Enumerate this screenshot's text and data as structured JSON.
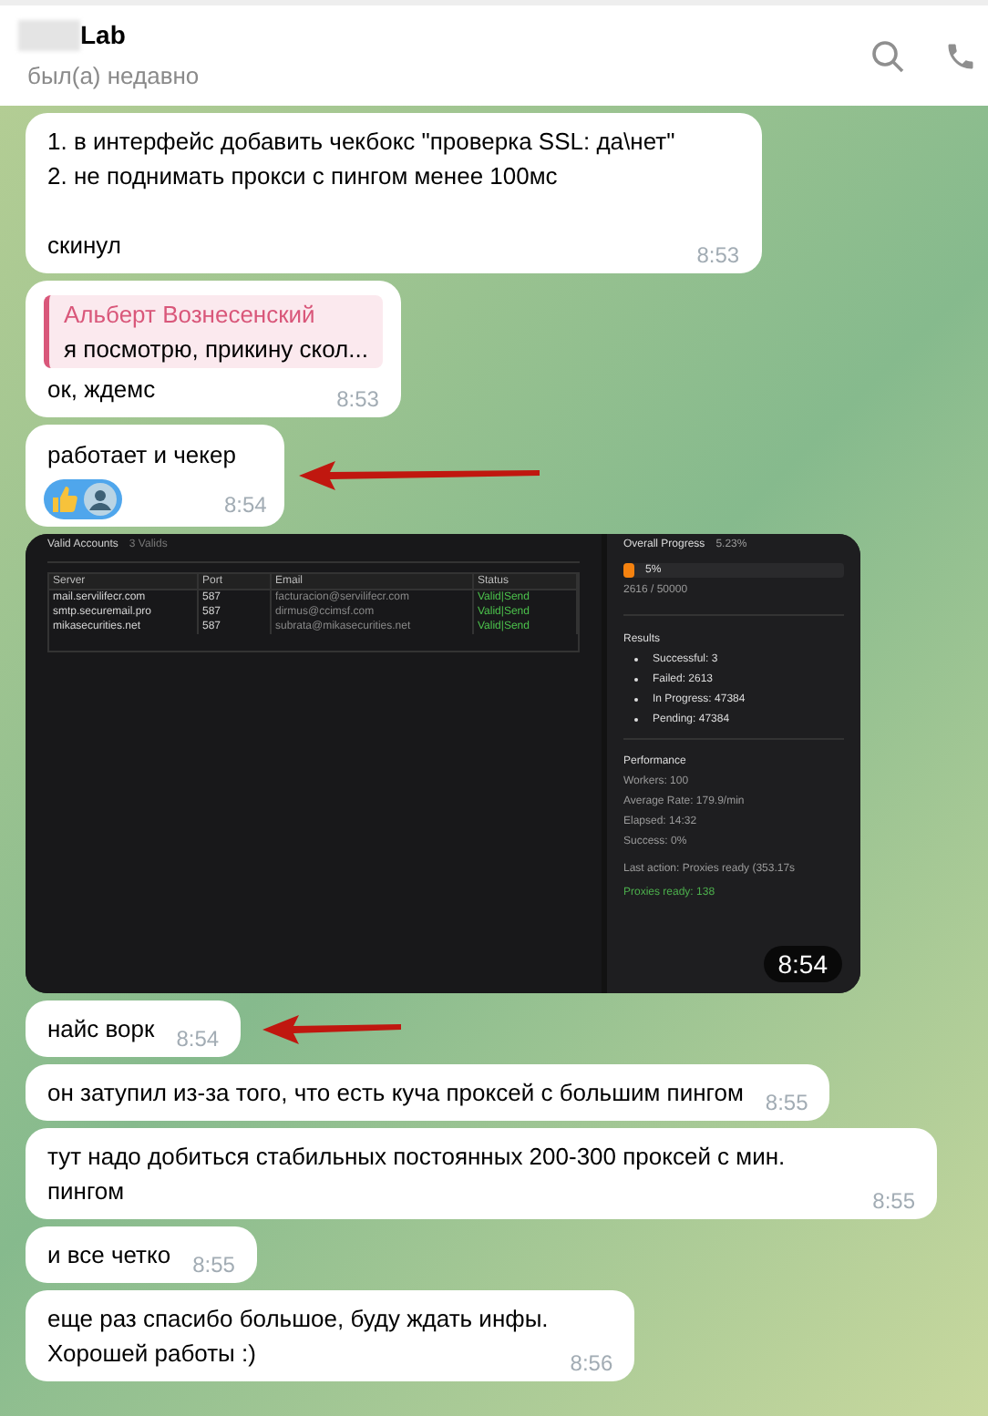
{
  "header": {
    "title": "Lab",
    "status": "был(а) недавно"
  },
  "messages": [
    {
      "kind": "text",
      "text": "1. в интерфейс добавить чекбокс \"проверка SSL: да\\нет\"\n2. не поднимать прокси с пингом менее 100мс\n\nскинул",
      "time": "8:53",
      "marked_with_arrow": false
    },
    {
      "kind": "reply",
      "reply_author": "Альберт Вознесенский",
      "reply_text": "я посмотрю, прикину скол...",
      "text": "ок, ждемс",
      "time": "8:53",
      "marked_with_arrow": false
    },
    {
      "kind": "reactions",
      "text": "работает и чекер",
      "time": "8:54",
      "marked_with_arrow": true
    },
    {
      "kind": "image",
      "time": "8:54",
      "marked_with_arrow": false,
      "screenshot": {
        "title": "Valid Accounts",
        "count": "3 Valids",
        "columns": [
          "Server",
          "Port",
          "Email",
          "Status"
        ],
        "rows": [
          [
            "mail.servilifecr.com",
            "587",
            "facturacion@servilifecr.com",
            "Valid|Send"
          ],
          [
            "smtp.securemail.pro",
            "587",
            "dirmus@ccimsf.com",
            "Valid|Send"
          ],
          [
            "mikasecurities.net",
            "587",
            "subrata@mikasecurities.net",
            "Valid|Send"
          ]
        ],
        "progress_title": "Overall Progress",
        "progress_percent": "5.23%",
        "level": 0.05,
        "progress_label": "5%",
        "progress_count": "2616 / 50000",
        "results_title": "Results",
        "results": [
          "Successful: 3",
          "Failed: 2613",
          "In Progress: 47384",
          "Pending: 47384"
        ],
        "performance_title": "Performance",
        "performance": [
          "Workers: 100",
          "Average Rate: 179.9/min",
          "Elapsed: 14:32",
          "Success: 0%"
        ],
        "last_action": "Last action: Proxies ready   (353.17s",
        "proxies_ready": "Proxies ready: 138"
      }
    },
    {
      "kind": "text",
      "text": "найс ворк",
      "time": "8:54",
      "marked_with_arrow": true
    },
    {
      "kind": "text",
      "text": "он затупил из-за того, что есть куча проксей с большим пингом",
      "time": "8:55",
      "marked_with_arrow": false
    },
    {
      "kind": "text",
      "text": "тут надо добиться стабильных постоянных 200-300 проксей с мин. пингом",
      "time": "8:55",
      "marked_with_arrow": false
    },
    {
      "kind": "text",
      "text": "и все четко",
      "time": "8:55",
      "marked_with_arrow": false
    },
    {
      "kind": "text",
      "text": "еще раз спасибо большое, буду ждать инфы.\nХорошей работы :)",
      "time": "8:56",
      "marked_with_arrow": false
    }
  ]
}
